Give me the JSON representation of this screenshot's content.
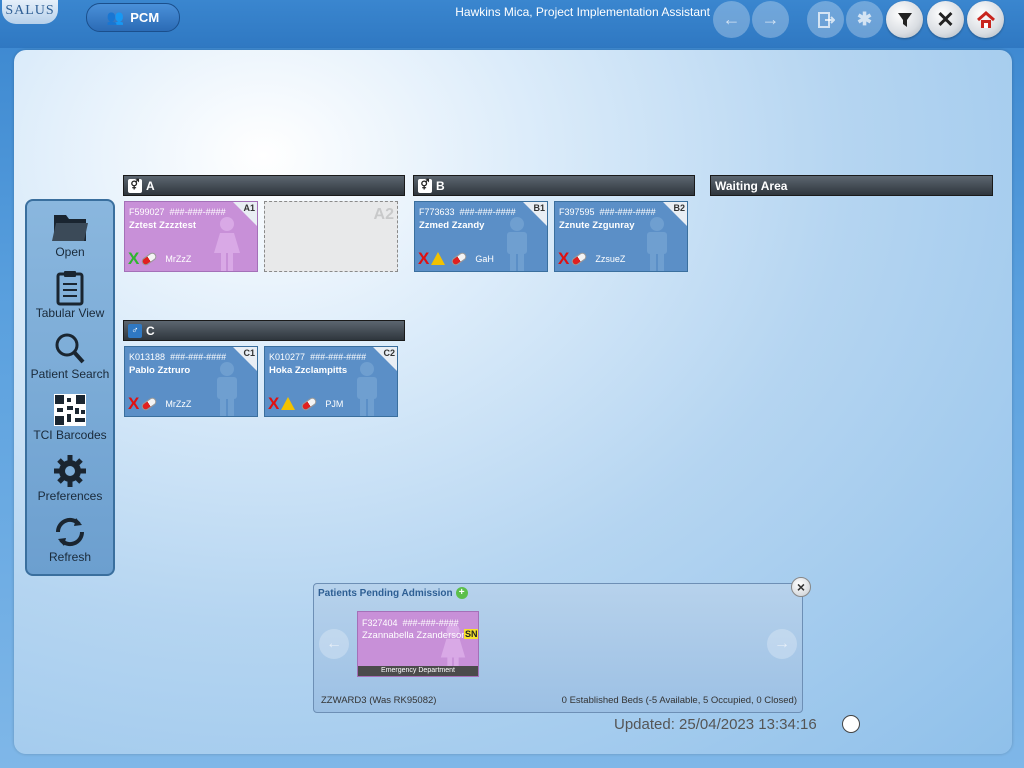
{
  "app": {
    "logo_text": "SALUS",
    "module_label": "PCM",
    "user": "Hawkins Mica, Project Implementation Assistant"
  },
  "toolbar": {
    "icons": [
      "arrow-left-icon",
      "arrow-right-icon",
      "exit-icon",
      "puzzle-icon",
      "filter-icon",
      "close-icon",
      "home-icon"
    ]
  },
  "sidebar": {
    "items": [
      {
        "label": "Open",
        "icon": "folder-icon"
      },
      {
        "label": "Tabular View",
        "icon": "clipboard-icon"
      },
      {
        "label": "Patient Search",
        "icon": "search-icon"
      },
      {
        "label": "TCI Barcodes",
        "icon": "qr-code-icon"
      },
      {
        "label": "Preferences",
        "icon": "gear-icon"
      },
      {
        "label": "Refresh",
        "icon": "refresh-icon"
      }
    ]
  },
  "bays": [
    {
      "name": "A",
      "beds": [
        {
          "bed": "A1",
          "id": "F599027",
          "nhs": "###-###-####",
          "name": "Zztest Zzzztest",
          "status": "green-x",
          "warning": false,
          "initials": "MrZzZ"
        },
        {
          "bed": "A2",
          "empty": true
        }
      ]
    },
    {
      "name": "B",
      "beds": [
        {
          "bed": "B1",
          "id": "F773633",
          "nhs": "###-###-####",
          "name": "Zzmed Zzandy",
          "status": "red-x",
          "warning": true,
          "initials": "GaH"
        },
        {
          "bed": "B2",
          "id": "F397595",
          "nhs": "###-###-####",
          "name": "Zznute Zzgunray",
          "status": "red-x",
          "warning": false,
          "initials": "ZzsueZ"
        }
      ]
    },
    {
      "name": "C",
      "beds": [
        {
          "bed": "C1",
          "id": "K013188",
          "nhs": "###-###-####",
          "name": "Pablo Zztruro",
          "status": "red-x",
          "warning": false,
          "initials": "MrZzZ"
        },
        {
          "bed": "C2",
          "id": "K010277",
          "nhs": "###-###-####",
          "name": "Hoka Zzclampitts",
          "status": "red-x",
          "warning": true,
          "initials": "PJM"
        }
      ]
    }
  ],
  "waiting_area": {
    "label": "Waiting Area"
  },
  "pending": {
    "title": "Patients Pending Admission",
    "card": {
      "id": "F327404",
      "nhs": "###-###-####",
      "name": "Zzannabella Zzanderson",
      "badge": "SN",
      "department": "Emergency Department"
    },
    "ward": "ZZWARD3 (Was RK95082)",
    "beds_summary": "0 Established Beds (-5 Available, 5 Occupied, 0 Closed)"
  },
  "updated": "Updated: 25/04/2023 13:34:16",
  "colors": {
    "female": "#c890d8",
    "male": "#5b8fc7",
    "header": "#2f363d"
  }
}
